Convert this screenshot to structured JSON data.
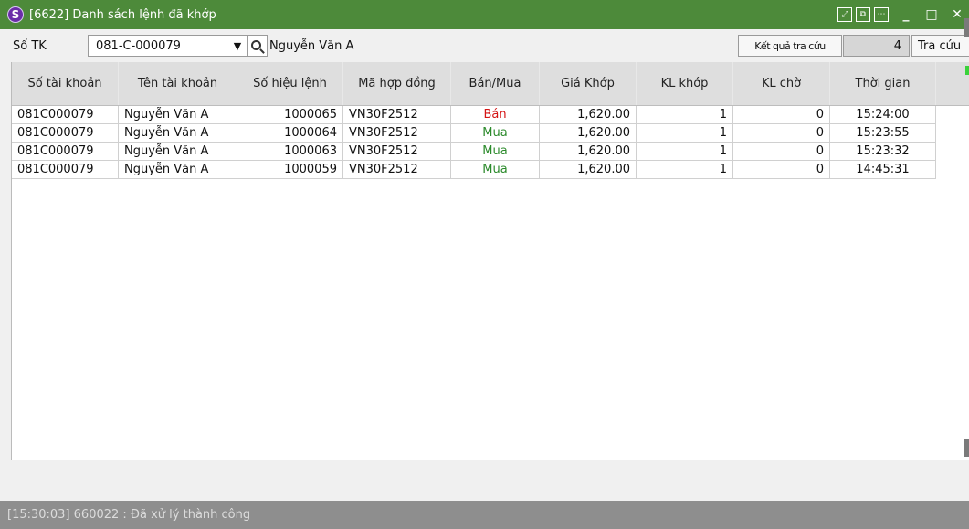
{
  "window": {
    "title": "[6622] Danh sách lệnh đã khớp",
    "app_icon": "S"
  },
  "toolbar": {
    "account_label": "Số TK",
    "account_value": "081-C-000079",
    "account_name": "Nguyễn Văn A",
    "result_label": "Kết quả tra cứu",
    "result_count": "4",
    "search_button": "Tra cứu"
  },
  "grid": {
    "columns": [
      "Số tài khoản",
      "Tên tài khoản",
      "Số hiệu lệnh",
      "Mã hợp đồng",
      "Bán/Mua",
      "Giá Khớp",
      "KL khớp",
      "KL chờ",
      "Thời gian"
    ],
    "rows": [
      [
        "081C000079",
        "Nguyễn Văn A",
        "1000065",
        "VN30F2512",
        "Bán",
        "1,620.00",
        "1",
        "0",
        "15:24:00"
      ],
      [
        "081C000079",
        "Nguyễn Văn A",
        "1000064",
        "VN30F2512",
        "Mua",
        "1,620.00",
        "1",
        "0",
        "15:23:55"
      ],
      [
        "081C000079",
        "Nguyễn Văn A",
        "1000063",
        "VN30F2512",
        "Mua",
        "1,620.00",
        "1",
        "0",
        "15:23:32"
      ],
      [
        "081C000079",
        "Nguyễn Văn A",
        "1000059",
        "VN30F2512",
        "Mua",
        "1,620.00",
        "1",
        "0",
        "14:45:31"
      ]
    ]
  },
  "status": {
    "message": "[15:30:03] 660022 : Đã xử lý thành công"
  },
  "colors": {
    "titlebar": "#4d8a3a",
    "buy": "#2b8a2b",
    "sell": "#d41414",
    "statusbar": "#8e8e8e"
  }
}
